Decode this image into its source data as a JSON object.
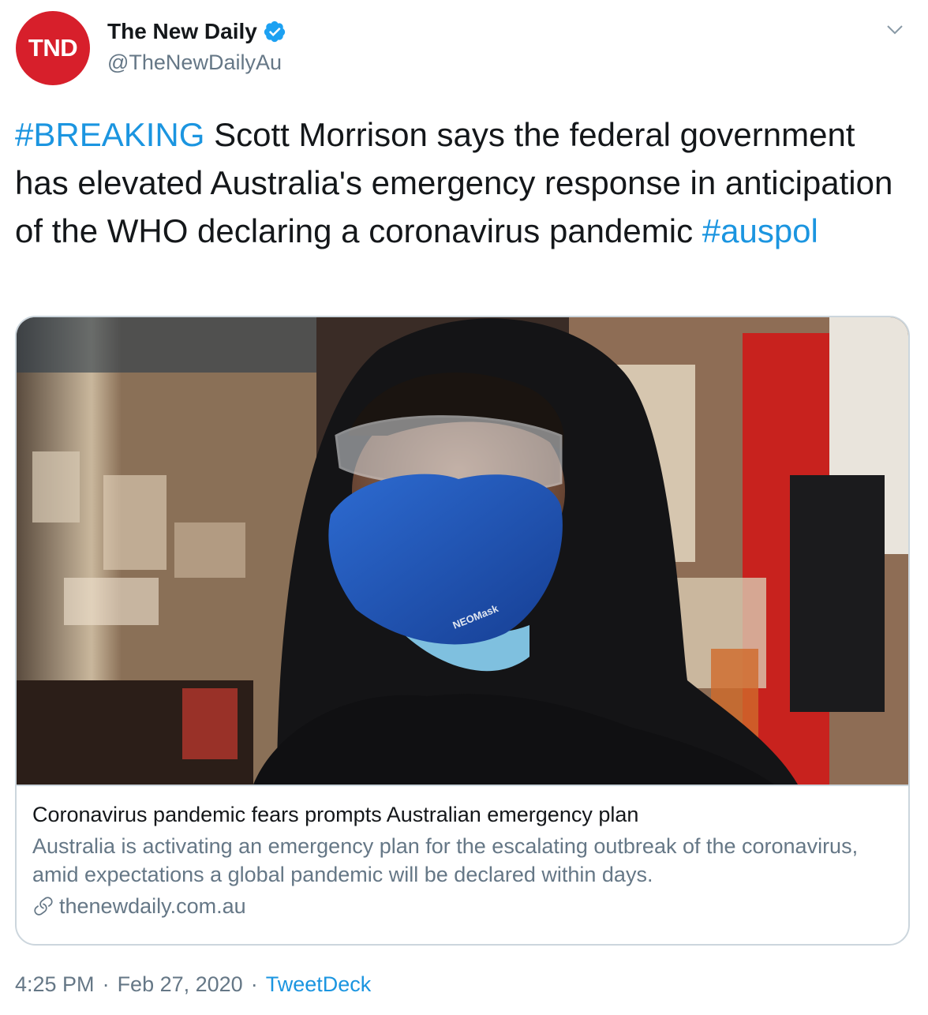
{
  "author": {
    "avatar_text": "TND",
    "display_name": "The New Daily",
    "handle": "@TheNewDailyAu",
    "verified": true
  },
  "tweet": {
    "hashtag_breaking": "#BREAKING",
    "text": " Scott Morrison says the federal government has elevated Australia's emergency response in anticipation of the WHO declaring a coronavirus pandemic ",
    "hashtag_auspol": "#auspol"
  },
  "card": {
    "mask_brand": "NEOMask",
    "title": "Coronavirus pandemic fears prompts Australian emergency plan",
    "description": "Australia is activating an emergency plan for the escalating outbreak of the coronavirus, amid expectations a global pandemic will be declared within days.",
    "domain": "thenewdaily.com.au"
  },
  "meta": {
    "time": "4:25 PM",
    "separator": "·",
    "date": "Feb 27, 2020",
    "source": "TweetDeck"
  },
  "colors": {
    "avatar_bg": "#d71f2b",
    "link_blue": "#1b95e0",
    "muted_gray": "#657786",
    "border": "#ccd6dd"
  }
}
